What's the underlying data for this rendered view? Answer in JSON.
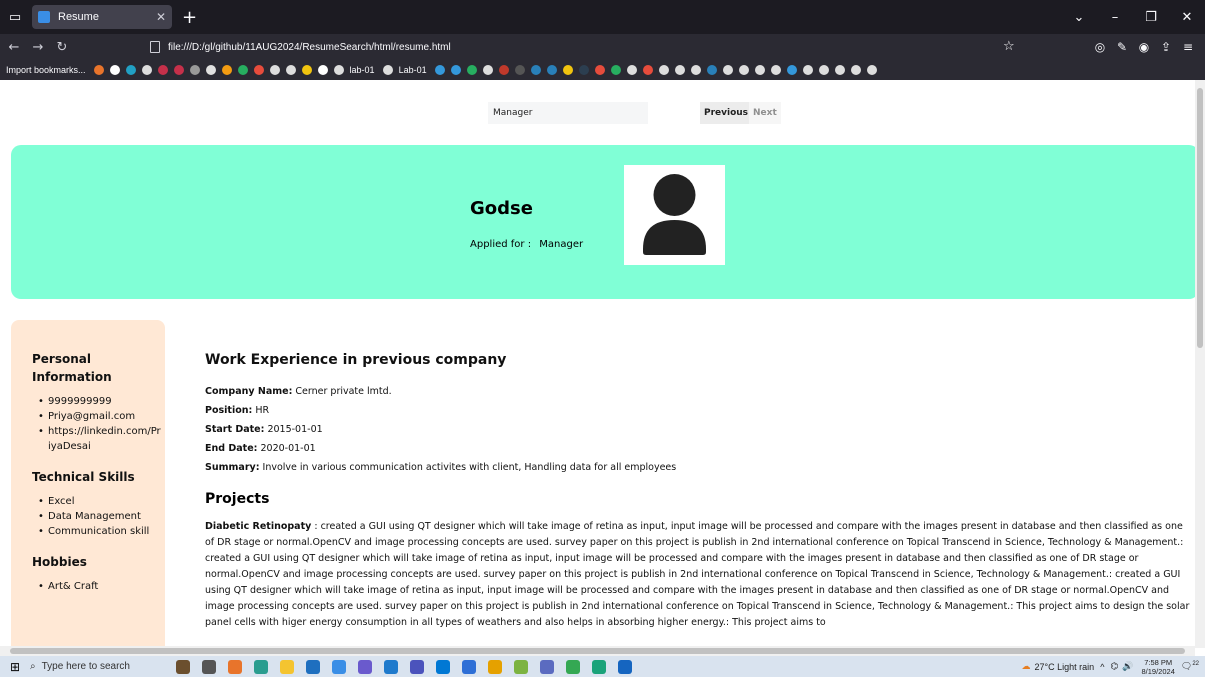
{
  "browser": {
    "tab_title": "Resume",
    "url": "file:///D:/gl/github/11AUG2024/ResumeSearch/html/resume.html",
    "bookmarks_import": "Import bookmarks...",
    "bookmark_labels": [
      "lab-01",
      "Lab-01"
    ]
  },
  "search": {
    "value": "Manager"
  },
  "pager": {
    "previous": "Previous",
    "next": "Next"
  },
  "candidate": {
    "name": "Godse",
    "applied_label": "Applied for :",
    "applied_value": "Manager"
  },
  "sidebar": {
    "personal_title": "Personal Information",
    "personal_items": [
      "9999999999",
      "Priya@gmail.com",
      "https://linkedin.com/PriyaDesai"
    ],
    "skills_title": "Technical Skills",
    "skills_items": [
      "Excel",
      "Data Management",
      "Communication skill"
    ],
    "hobbies_title": "Hobbies",
    "hobbies_items": [
      "Art& Craft"
    ]
  },
  "experience": {
    "title": "Work Experience in previous company",
    "company_label": "Company Name:",
    "company": "Cerner private lmtd.",
    "position_label": "Position:",
    "position": "HR",
    "start_label": "Start Date:",
    "start": "2015-01-01",
    "end_label": "End Date:",
    "end": "2020-01-01",
    "summary_label": "Summary:",
    "summary": "Involve in various communication activites with client, Handling data for all employees"
  },
  "projects": {
    "title": "Projects",
    "project_name": "Diabetic Retinopaty",
    "project_text": ": created a GUI using QT designer which will take image of retina as input, input image will be processed and compare with the images present in database and then classified as one of DR stage or normal.OpenCV and image processing concepts are used. survey paper on this project is publish in 2nd international conference on Topical Transcend in Science, Technology & Management.: created a GUI using QT designer which will take image of retina as input, input image will be processed and compare with the images present in database and then classified as one of DR stage or normal.OpenCV and image processing concepts are used. survey paper on this project is publish in 2nd international conference on Topical Transcend in Science, Technology & Management.: created a GUI using QT designer which will take image of retina as input, input image will be processed and compare with the images present in database and then classified as one of DR stage or normal.OpenCV and image processing concepts are used. survey paper on this project is publish in 2nd international conference on Topical Transcend in Science, Technology & Management.: This project aims to design the solar panel cells with higer energy consumption in all types of weathers and also helps in absorbing higher energy.: This project aims to"
  },
  "taskbar": {
    "search_placeholder": "Type here to search",
    "weather": "27°C  Light rain",
    "time": "7:58 PM",
    "date": "8/19/2024",
    "notifications": "22"
  }
}
